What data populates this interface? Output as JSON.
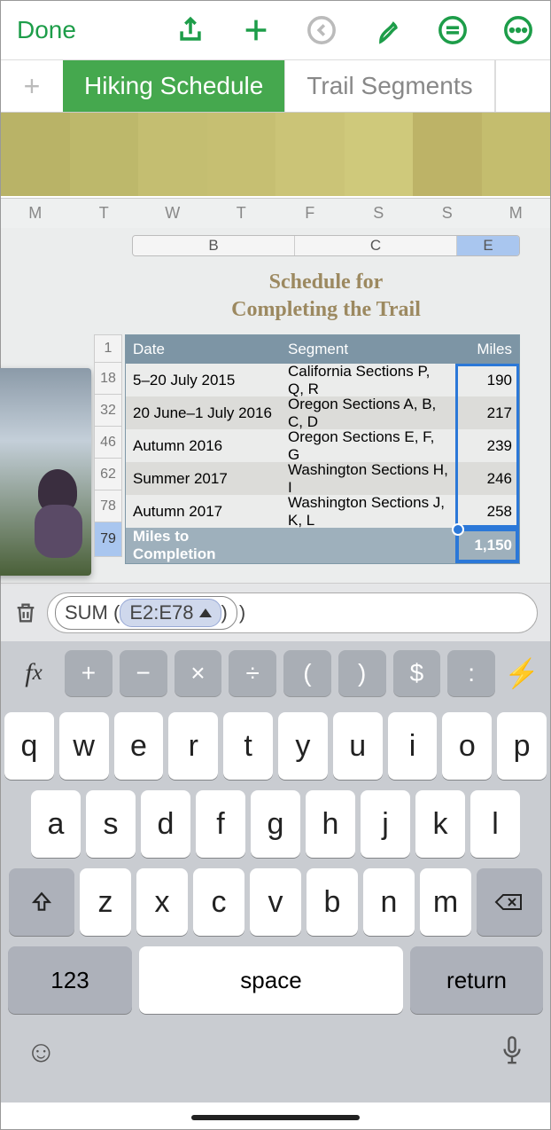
{
  "toolbar": {
    "done": "Done"
  },
  "tabs": {
    "active": "Hiking Schedule",
    "inactive": "Trail Segments"
  },
  "weekdays": [
    "M",
    "T",
    "W",
    "T",
    "F",
    "S",
    "S",
    "M"
  ],
  "columns": [
    "B",
    "C",
    "E"
  ],
  "title_line1": "Schedule for",
  "title_line2": "Completing the Trail",
  "headers": {
    "date": "Date",
    "segment": "Segment",
    "miles": "Miles"
  },
  "rows": [
    {
      "n": "1"
    },
    {
      "n": "18",
      "date": "5–20 July 2015",
      "segment": "California Sections P, Q, R",
      "miles": "190"
    },
    {
      "n": "32",
      "date": "20 June–1 July 2016",
      "segment": "Oregon Sections A, B, C, D",
      "miles": "217"
    },
    {
      "n": "46",
      "date": "Autumn 2016",
      "segment": "Oregon Sections E, F, G",
      "miles": "239"
    },
    {
      "n": "62",
      "date": "Summer 2017",
      "segment": "Washington Sections H, I",
      "miles": "246"
    },
    {
      "n": "78",
      "date": "Autumn 2017",
      "segment": "Washington Sections J, K, L",
      "miles": "258"
    }
  ],
  "total": {
    "n": "79",
    "label": "Miles to Completion",
    "value": "1,150"
  },
  "formula": {
    "fn": "SUM",
    "range": "E2:E78"
  },
  "fnkeys": [
    "+",
    "−",
    "×",
    "÷",
    "(",
    ")",
    "$",
    ":"
  ],
  "kbd": {
    "r1": [
      "q",
      "w",
      "e",
      "r",
      "t",
      "y",
      "u",
      "i",
      "o",
      "p"
    ],
    "r2": [
      "a",
      "s",
      "d",
      "f",
      "g",
      "h",
      "j",
      "k",
      "l"
    ],
    "r3": [
      "z",
      "x",
      "c",
      "v",
      "b",
      "n",
      "m"
    ],
    "num": "123",
    "space": "space",
    "ret": "return"
  }
}
